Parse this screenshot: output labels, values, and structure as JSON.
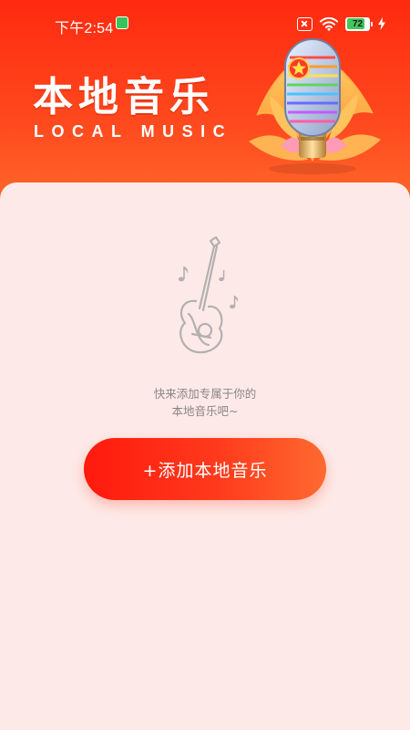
{
  "status_bar": {
    "time": "下午2:54",
    "battery_level": "72",
    "icons": [
      "app-notification-icon",
      "sim-off-icon",
      "wifi-icon",
      "battery-icon",
      "charging-bolt-icon"
    ]
  },
  "header": {
    "title_cn": "本地音乐",
    "title_en": "LOCAL MUSIC",
    "illustration": "microphone-icon"
  },
  "empty_state": {
    "icon": "guitar-icon",
    "hint_line1": "快来添加专属于你的",
    "hint_line2": "本地音乐吧~"
  },
  "actions": {
    "add_label": "+添加本地音乐"
  },
  "colors": {
    "brand_red": "#ff2a10",
    "brand_orange": "#ff6a2c",
    "background": "#fdeae8",
    "hint_text": "#8c8585"
  }
}
